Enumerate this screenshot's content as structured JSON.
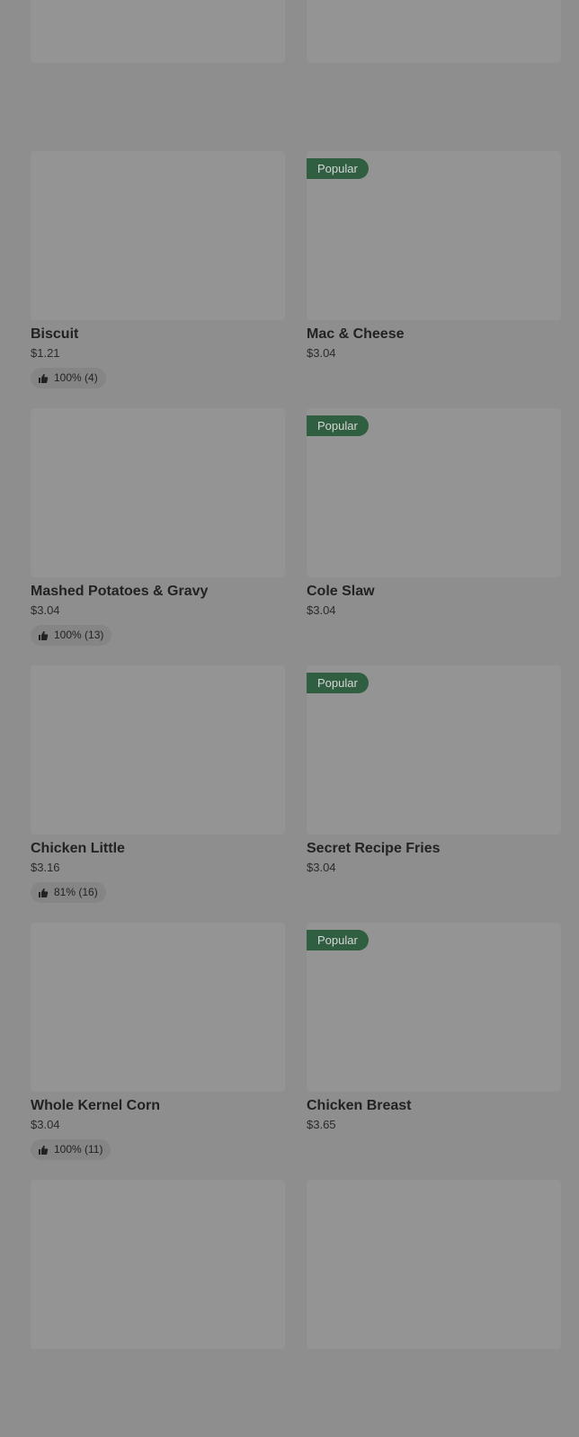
{
  "items": [
    {
      "name": "",
      "price": "",
      "rating": "",
      "popular": false
    },
    {
      "name": "",
      "price": "",
      "rating": "",
      "popular": true
    },
    {
      "name": "Biscuit",
      "price": "$1.21",
      "rating": "100% (4)",
      "popular": false
    },
    {
      "name": "Mac & Cheese",
      "price": "$3.04",
      "rating": "",
      "popular": true
    },
    {
      "name": "Mashed Potatoes & Gravy",
      "price": "$3.04",
      "rating": "100% (13)",
      "popular": false
    },
    {
      "name": "Cole Slaw",
      "price": "$3.04",
      "rating": "",
      "popular": true
    },
    {
      "name": "Chicken Little",
      "price": "$3.16",
      "rating": "81% (16)",
      "popular": false
    },
    {
      "name": "Secret Recipe Fries",
      "price": "$3.04",
      "rating": "",
      "popular": true
    },
    {
      "name": "Whole Kernel Corn",
      "price": "$3.04",
      "rating": "100% (11)",
      "popular": false
    },
    {
      "name": "Chicken Breast",
      "price": "$3.65",
      "rating": "",
      "popular": true
    },
    {
      "name": "",
      "price": "",
      "rating": "",
      "popular": false
    },
    {
      "name": "",
      "price": "",
      "rating": "",
      "popular": false
    }
  ],
  "labels": {
    "popular": "Popular"
  },
  "icons": {
    "rating": "thumbs-up-icon"
  }
}
